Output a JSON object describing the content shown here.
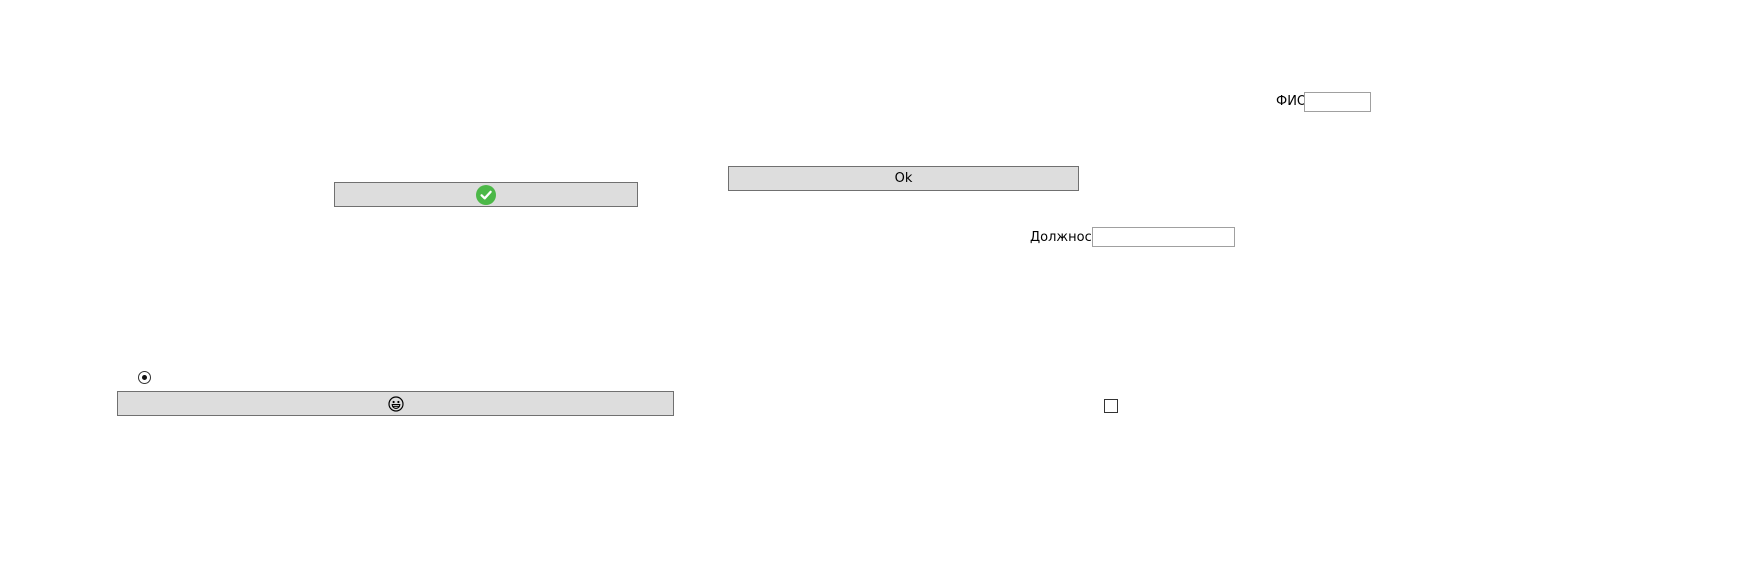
{
  "form": {
    "ok_button": {
      "label": "Ok"
    },
    "check_button": {
      "icon": "check-circle-icon",
      "icon_color": "#4cb848"
    },
    "emoji_button": {
      "icon": "grinning-face-icon"
    },
    "full_name": {
      "label": "ФИО",
      "value": ""
    },
    "position": {
      "label": "Должность",
      "value": ""
    },
    "radio": {
      "checked": true
    },
    "checkbox": {
      "checked": false
    }
  },
  "colors": {
    "button_bg": "#dddddd",
    "button_border": "#707070",
    "input_border": "#a0a0a0"
  }
}
